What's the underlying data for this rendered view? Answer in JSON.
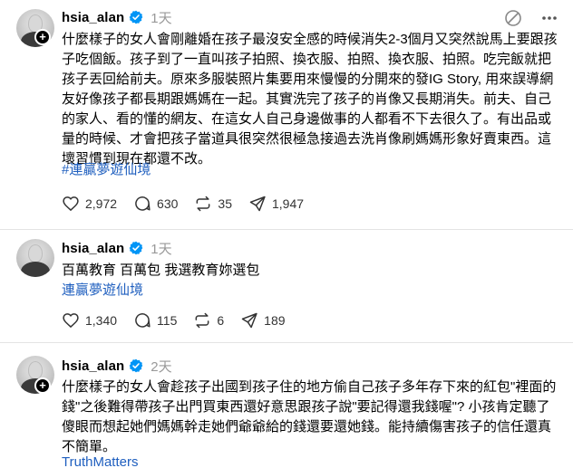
{
  "posts": [
    {
      "username": "hsia_alan",
      "time": "1天",
      "text": "什麼樣子的女人會剛離婚在孩子最沒安全感的時候消失2-3個月又突然說馬上要跟孩子吃個飯。孩子到了一直叫孩子拍照、換衣服、拍照、換衣服、拍照。吃完飯就把孩子丟回給前夫。原來多服裝照片集要用來慢慢的分開來的發IG Story, 用來誤導網友好像孩子都長期跟媽媽在一起。其實洗完了孩子的肖像又長期消失。前夫、自己的家人、看的懂的網友、在這女人自己身邊做事的人都看不下去很久了。有出品或量的時候、才會把孩子當道具很突然很極急接過去洗肖像刷媽媽形象好賣東西。這壞習慣到現在都還不改。",
      "link": "#連贏夢遊仙境",
      "likes": "2,972",
      "comments": "630",
      "reposts": "35",
      "shares": "1,947"
    },
    {
      "username": "hsia_alan",
      "time": "1天",
      "text": "百萬教育 百萬包 我選教育妳選包",
      "link": "連贏夢遊仙境",
      "likes": "1,340",
      "comments": "115",
      "reposts": "6",
      "shares": "189"
    },
    {
      "username": "hsia_alan",
      "time": "2天",
      "text": "什麼樣子的女人會趁孩子出國到孩子住的地方偷自己孩子多年存下來的紅包\"裡面的錢\"之後難得帶孩子出門買東西還好意思跟孩子說\"要記得還我錢喔\"? 小孩肯定聽了傻眼而想起她們媽媽幹走她們爺爺給的錢還要還她錢。能持續傷害孩子的信任還真不簡單。",
      "link": "TruthMatters"
    }
  ],
  "colors": {
    "link": "#1f5fbf",
    "verified": "#0095f6",
    "muted": "#999999",
    "separator": "#e3e3e3"
  },
  "icons": {
    "top": [
      "edit-slash-icon",
      "more-options-icon"
    ],
    "actions": [
      "heart-icon",
      "comment-icon",
      "repost-icon",
      "share-icon"
    ]
  }
}
